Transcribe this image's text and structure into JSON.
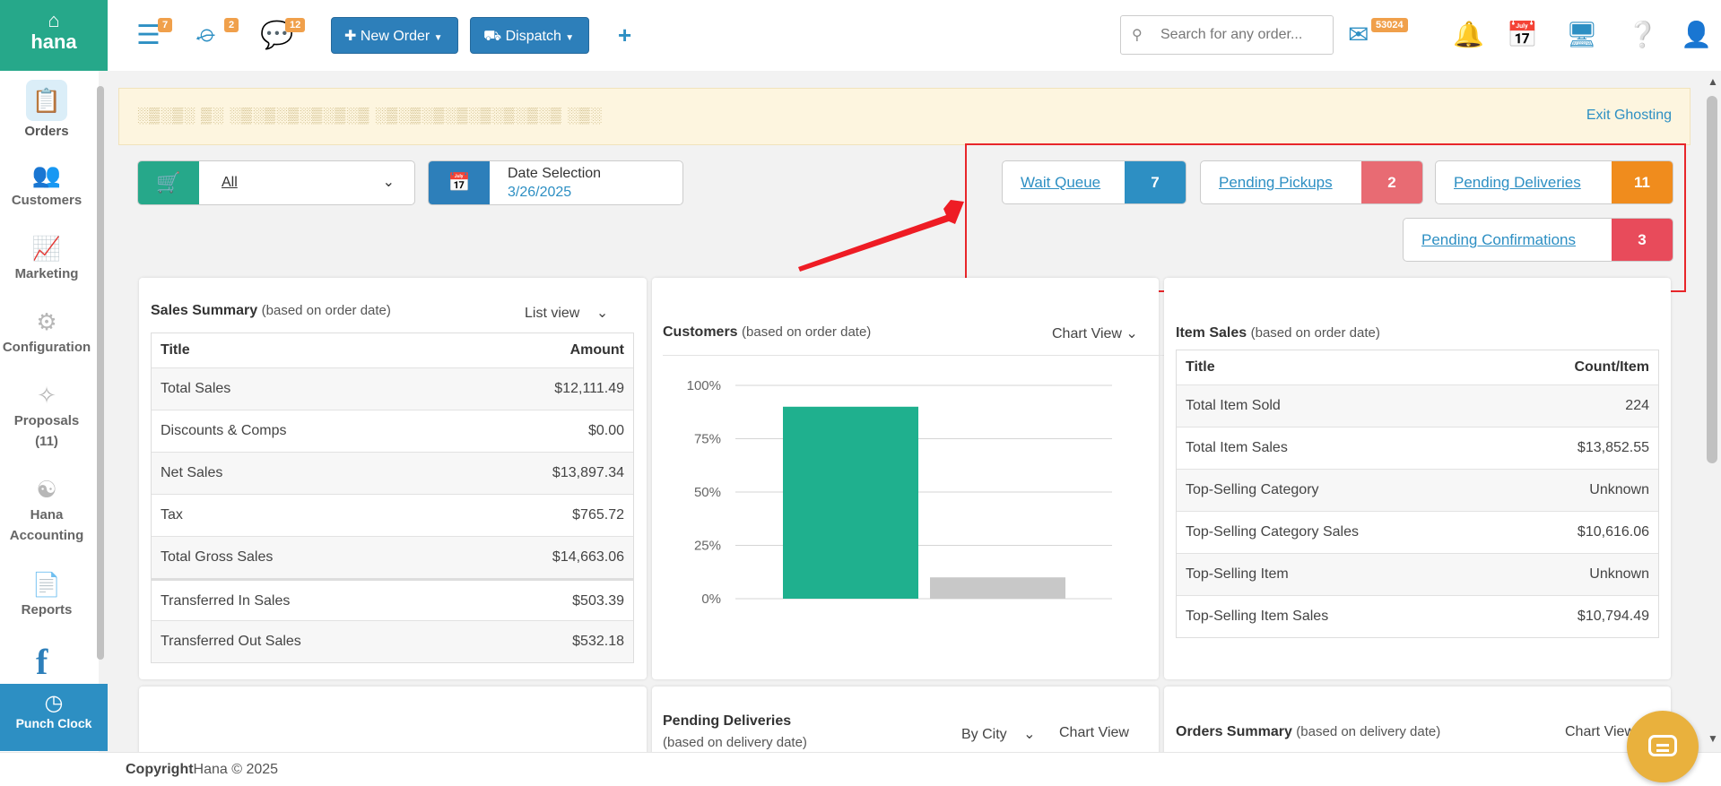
{
  "topbar": {
    "logo_icon": "home-icon",
    "logo_text": "hana",
    "stack_badge": "7",
    "basket_badge": "2",
    "chat_badge": "12",
    "new_order_label": "New Order",
    "dispatch_label": "Dispatch",
    "search_placeholder": "Search for any order...",
    "mail_badge": "53024"
  },
  "sidebar": {
    "items": [
      {
        "label": "Orders",
        "icon": "orders-icon"
      },
      {
        "label": "Customers",
        "icon": "customers-icon"
      },
      {
        "label": "Marketing",
        "icon": "marketing-icon"
      },
      {
        "label": "Configuration",
        "icon": "configuration-icon"
      },
      {
        "label": "Proposals",
        "count": "(11)",
        "icon": "proposals-icon"
      },
      {
        "label": "Hana",
        "label2": "Accounting",
        "icon": "accounting-icon"
      },
      {
        "label": "Reports",
        "icon": "reports-icon"
      }
    ],
    "facebook_glyph": "f",
    "punch_clock_label": "Punch Clock"
  },
  "banner": {
    "text": "░▒░▒░ ▒░ ░▒░▒░▒░▒░▒░▒ ░▒░▒░▒░▒░▒░▒░▒░▒ ░▒░",
    "exit_label": "Exit Ghosting"
  },
  "filters": {
    "store_value": "All",
    "date_label": "Date Selection",
    "date_value": "3/26/2025"
  },
  "queues": {
    "wait_queue": {
      "label": "Wait Queue",
      "count": "7",
      "color": "#2d8fc3"
    },
    "pending_pickups": {
      "label": "Pending Pickups",
      "count": "2",
      "color": "#e86b73"
    },
    "pending_deliveries": {
      "label": "Pending Deliveries",
      "count": "11",
      "color": "#f08c1d"
    },
    "pending_confirmations": {
      "label": "Pending Confirmations",
      "count": "3",
      "color": "#e84b5b"
    }
  },
  "sales_summary": {
    "title": "Sales Summary",
    "subtitle": "(based on order date)",
    "view": "List view",
    "col_title": "Title",
    "col_amount": "Amount",
    "rows": [
      {
        "title": "Total Sales",
        "amount": "$12,111.49"
      },
      {
        "title": "Discounts & Comps",
        "amount": "$0.00"
      },
      {
        "title": "Net Sales",
        "amount": "$13,897.34"
      },
      {
        "title": "Tax",
        "amount": "$765.72"
      },
      {
        "title": "Total Gross Sales",
        "amount": "$14,663.06"
      },
      {
        "title": "Transferred In Sales",
        "amount": "$503.39"
      },
      {
        "title": "Transferred Out Sales",
        "amount": "$532.18"
      }
    ]
  },
  "customers": {
    "title": "Customers",
    "subtitle": "(based on order date)",
    "view": "Chart View"
  },
  "chart_data": {
    "type": "bar",
    "title": "",
    "categories": [
      "",
      ""
    ],
    "values": [
      90,
      10
    ],
    "colors": [
      "#1fb08e",
      "#c8c8c8"
    ],
    "ylim": [
      0,
      100
    ],
    "yticks": [
      "100%",
      "75%",
      "50%",
      "25%",
      "0%"
    ],
    "ytick_values": [
      100,
      75,
      50,
      25,
      0
    ],
    "grid": true,
    "xlabel": "",
    "ylabel": ""
  },
  "item_sales": {
    "title": "Item Sales",
    "subtitle": "(based on order date)",
    "col_title": "Title",
    "col_count": "Count/Item",
    "rows": [
      {
        "title": "Total Item Sold",
        "value": "224"
      },
      {
        "title": "Total Item Sales",
        "value": "$13,852.55"
      },
      {
        "title": "Top-Selling Category",
        "value": "Unknown"
      },
      {
        "title": "Top-Selling Category Sales",
        "value": "$10,616.06"
      },
      {
        "title": "Top-Selling Item",
        "value": "Unknown"
      },
      {
        "title": "Top-Selling Item Sales",
        "value": "$10,794.49"
      }
    ]
  },
  "pending_deliveries_card": {
    "title": "Pending Deliveries",
    "subtitle": "(based on delivery date)",
    "group": "By City",
    "view": "Chart View"
  },
  "orders_summary": {
    "title": "Orders Summary",
    "subtitle": "(based on delivery date)",
    "view": "Chart View"
  },
  "footer": {
    "copyright_bold": "Copyright",
    "copyright_text": "Hana © 2025"
  }
}
